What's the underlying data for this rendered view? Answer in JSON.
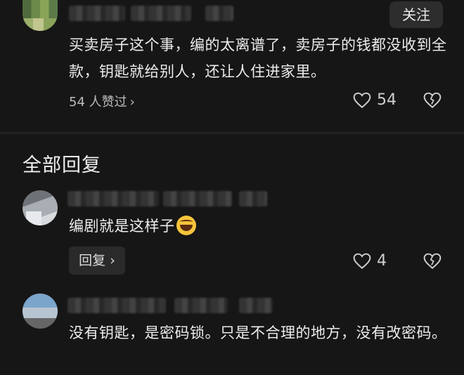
{
  "top_comment": {
    "follow_label": "关注",
    "text": "买卖房子这个事，编的太离谱了，卖房子的钱都没收到全款，钥匙就给别人，还让人住进家里。",
    "likes_link": "54 人赞过",
    "like_count": "54"
  },
  "replies_section": {
    "title": "全部回复"
  },
  "replies": [
    {
      "text": "编剧就是这样子",
      "reply_label": "回复",
      "like_count": "4"
    },
    {
      "text": "没有钥匙，是密码锁。只是不合理的地方，没有改密码。"
    }
  ],
  "icons": {
    "like": "heart-outline-icon",
    "dislike": "broken-heart-icon",
    "chevron": "chevron-right-icon",
    "emoji": "laughing-emoji-icon"
  }
}
